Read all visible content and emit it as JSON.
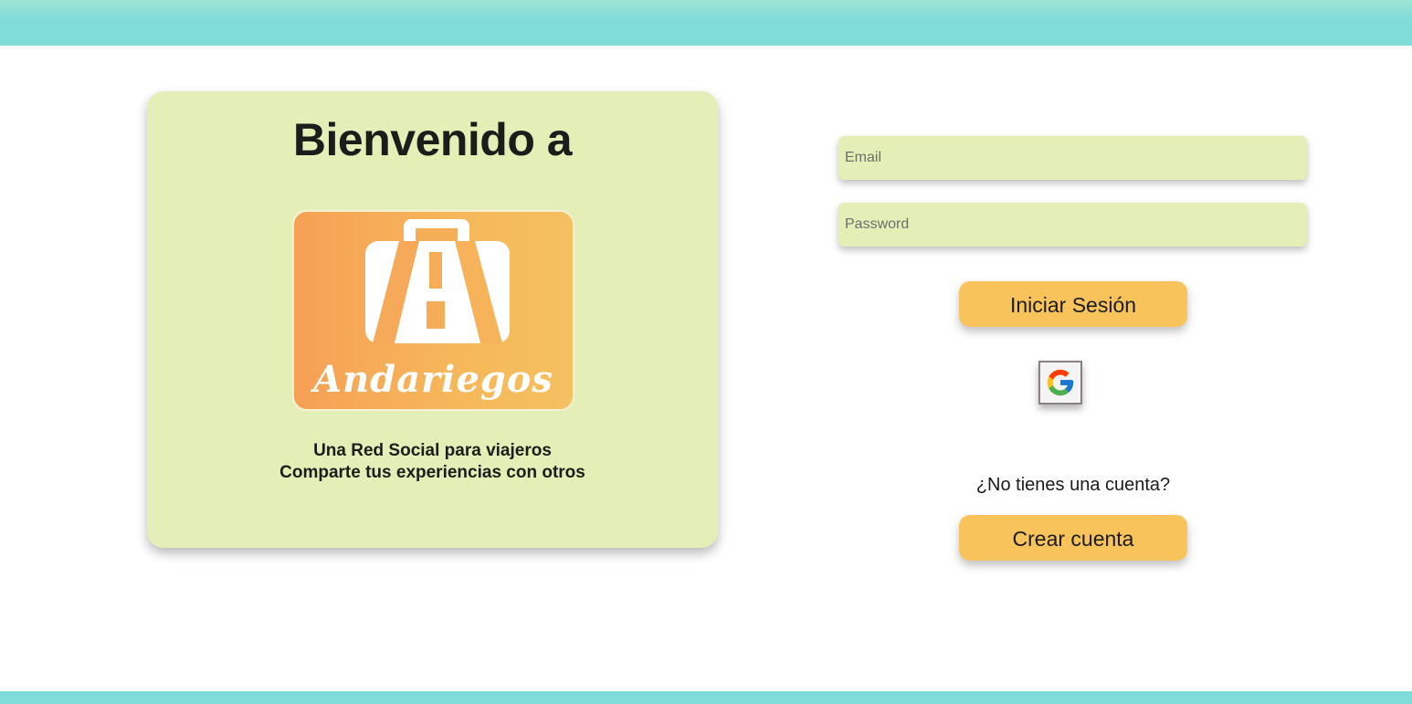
{
  "welcome": {
    "title": "Bienvenido a",
    "logo_text": "Andariegos",
    "tagline_line1": "Una Red Social para viajeros",
    "tagline_line2": "Comparte tus experiencias con otros"
  },
  "login_form": {
    "email_placeholder": "Email",
    "password_placeholder": "Password",
    "login_button_label": "Iniciar Sesión",
    "google_icon": "google-icon"
  },
  "signup": {
    "prompt": "¿No tienes una cuenta?",
    "create_button_label": "Crear cuenta"
  },
  "colors": {
    "header_bar": "#7fdcd9",
    "card_background": "#e4efb8",
    "button": "#f9c35c",
    "logo_gradient_start": "#f6a055",
    "logo_gradient_end": "#f4c060"
  }
}
